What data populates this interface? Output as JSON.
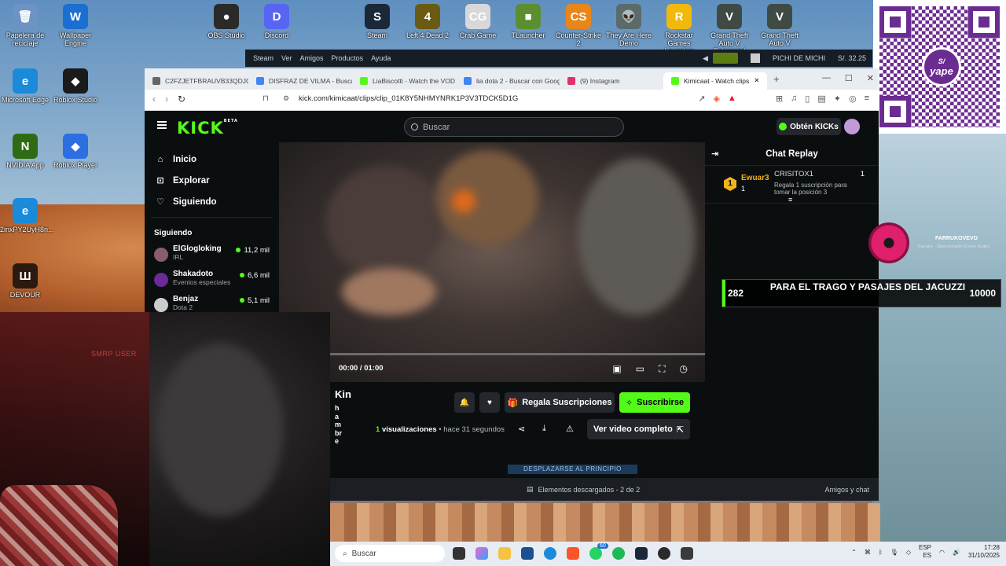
{
  "desktop": {
    "icons": [
      {
        "label": "Papelera de reciclaje",
        "glyph": "🗑",
        "color": "#6d93c4"
      },
      {
        "label": "Wallpaper Engine",
        "glyph": "W",
        "color": "#1a6fd1"
      },
      {
        "label": "OBS Studio",
        "glyph": "●",
        "color": "#2a2a2a"
      },
      {
        "label": "Discord",
        "glyph": "D",
        "color": "#5865f2"
      },
      {
        "label": "Steam",
        "glyph": "S",
        "color": "#1b2838"
      },
      {
        "label": "Left 4 Dead 2",
        "glyph": "4",
        "color": "#6b5a12"
      },
      {
        "label": "Crab Game",
        "glyph": "CG",
        "color": "#d8d8d8"
      },
      {
        "label": "TLauncher",
        "glyph": "■",
        "color": "#5b8e2f"
      },
      {
        "label": "Counter-Strike 2",
        "glyph": "CS",
        "color": "#e8851b"
      },
      {
        "label": "They Are Here Demo",
        "glyph": "👽",
        "color": "#5a6b6a"
      },
      {
        "label": "Rockstar Games Launcher",
        "glyph": "R",
        "color": "#f0b90b"
      },
      {
        "label": "Grand Theft Auto V Enhanced",
        "glyph": "V",
        "color": "#3f4a45"
      },
      {
        "label": "Grand Theft Auto V",
        "glyph": "V",
        "color": "#3f4a45"
      },
      {
        "label": "Microsoft Edge",
        "glyph": "e",
        "color": "#1a8ad9"
      },
      {
        "label": "Roblox Studio",
        "glyph": "◆",
        "color": "#1b1b1b"
      },
      {
        "label": "NVIDIA App",
        "glyph": "N",
        "color": "#2e6b14"
      },
      {
        "label": "Roblox Player",
        "glyph": "◆",
        "color": "#2d6ee0"
      },
      {
        "label": "2inxPY2UyH8n...",
        "glyph": "e",
        "color": "#1a8ad9"
      },
      {
        "label": "DEVOUR",
        "glyph": "Ш",
        "color": "#2b1a0f"
      }
    ]
  },
  "qr": {
    "brand": "yape"
  },
  "steam": {
    "menu": [
      "Steam",
      "Ver",
      "Amigos",
      "Productos",
      "Ayuda"
    ],
    "user": "PICHI DE MICHI",
    "wallet": "S/. 32.25"
  },
  "browser": {
    "tabs": [
      {
        "title": "C2FZJETFBRAUVB33QDJQX",
        "color": "#666"
      },
      {
        "title": "DISFRAZ DE VILMA - Buscar",
        "color": "#4285f4"
      },
      {
        "title": "LiaBiscotti - Watch the VOD",
        "color": "#53fc18"
      },
      {
        "title": "lia dota 2 - Buscar con Google",
        "color": "#4285f4"
      },
      {
        "title": "(9) Instagram",
        "color": "#e1306c"
      },
      {
        "title": "Kimicaat - Watch clips",
        "color": "#53fc18"
      }
    ],
    "url": "kick.com/kimicaat/clips/clip_01K8Y5NHMYNRK1P3V3TDCK5D1G"
  },
  "kick": {
    "search_placeholder": "Buscar",
    "get_kicks": "Obtén KICKs",
    "nav": [
      {
        "label": "Inicio",
        "icon": "⌂"
      },
      {
        "label": "Explorar",
        "icon": "⊡"
      },
      {
        "label": "Siguiendo",
        "icon": "♡"
      }
    ],
    "following_heading": "Siguiendo",
    "following": [
      {
        "name": "ElGlogloking",
        "category": "IRL",
        "viewers": "11,2 mil",
        "color": "#8a5c6f"
      },
      {
        "name": "Shakadoto",
        "category": "Eventos especiales",
        "viewers": "6,6 mil",
        "color": "#6a2a9a"
      },
      {
        "name": "Benjaz",
        "category": "Dota 2",
        "viewers": "5,1 mil",
        "color": "#cccccc"
      }
    ],
    "video": {
      "time": "00:00 / 01:00",
      "progress": 0
    },
    "chat": {
      "title": "Chat Replay",
      "gift": {
        "rank": "1",
        "top_user": "Ewuar3",
        "top_count": "1",
        "gifter": "CRISITOX1",
        "gifter_count": "1",
        "message": "Regala 1 suscripción para tomar la posición 3"
      }
    },
    "channel": {
      "name": "Kin",
      "vertical": "hambre"
    },
    "buttons": {
      "gift_subs": "Regala Suscripciones",
      "subscribe": "Suscribirse",
      "full_video": "Ver video completo"
    },
    "meta": {
      "views": "1",
      "views_label": "visualizaciones",
      "ago": "• hace 31 segundos"
    },
    "scroll_top": "DESPLAZARSE AL PRINCIPIO",
    "downloads": "Elementos descargados - 2 de 2",
    "friends_chat": "Amigos y chat"
  },
  "overlays": {
    "webcam_label": "SMRP USER",
    "music": {
      "artist": "FARRUKOVEVO",
      "track": "Farruko - Obsesionado (Cover Audio)"
    },
    "goal": {
      "current": "282",
      "text": "PARA EL TRAGO Y PASAJES DEL JACUZZI",
      "target": "10000"
    }
  },
  "taskbar": {
    "search": "Buscar",
    "badge": "60",
    "lang": "ESP",
    "lang_sub": "ES",
    "time": "17:28",
    "date": "31/10/2025"
  }
}
